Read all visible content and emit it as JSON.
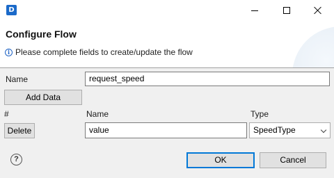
{
  "window": {
    "app_icon_letter": "D",
    "icons": [
      "app-icon",
      "minimize-icon",
      "maximize-icon",
      "close-icon"
    ]
  },
  "header": {
    "title": "Configure Flow",
    "info_icon": "info-icon",
    "message": "Please complete fields to create/update the flow"
  },
  "form": {
    "name_label": "Name",
    "name_value": "request_speed",
    "add_data_label": "Add Data",
    "table": {
      "col_index": "#",
      "col_name": "Name",
      "col_type": "Type",
      "rows": [
        {
          "delete_label": "Delete",
          "name": "value",
          "type": "SpeedType"
        }
      ]
    }
  },
  "footer": {
    "help_icon": "help-icon",
    "help_glyph": "?",
    "ok_label": "OK",
    "cancel_label": "Cancel"
  }
}
